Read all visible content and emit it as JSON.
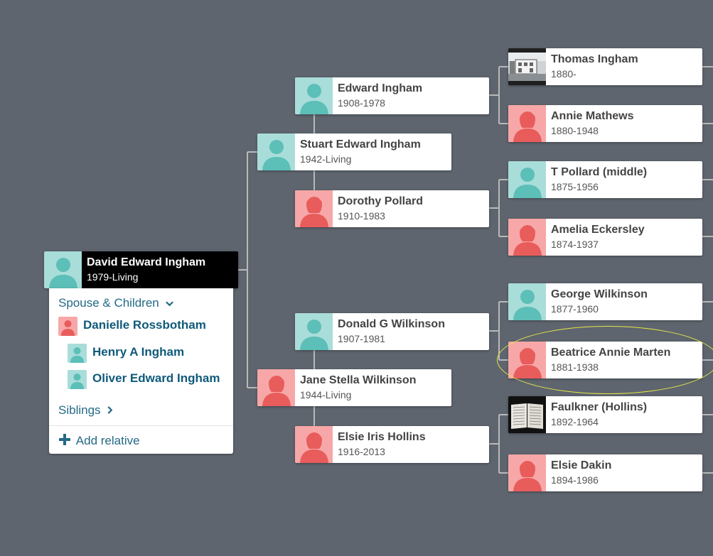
{
  "focus_person": {
    "name": "David Edward Ingham",
    "dates": "1979-Living"
  },
  "panel": {
    "spouse_children_label": "Spouse & Children",
    "spouse": "Danielle Rossbotham",
    "children": [
      "Henry A Ingham",
      "Oliver Edward Ingham"
    ],
    "siblings_label": "Siblings",
    "add_relative_label": "Add relative"
  },
  "parents": [
    {
      "name": "Stuart Edward Ingham",
      "dates": "1942-Living"
    },
    {
      "name": "Jane Stella Wilkinson",
      "dates": "1944-Living"
    }
  ],
  "grandparents": [
    {
      "name": "Edward Ingham",
      "dates": "1908-1978"
    },
    {
      "name": "Dorothy Pollard",
      "dates": "1910-1983"
    },
    {
      "name": "Donald G Wilkinson",
      "dates": "1907-1981"
    },
    {
      "name": "Elsie Iris Hollins",
      "dates": "1916-2013"
    }
  ],
  "great_grandparents": [
    {
      "name": "Thomas Ingham",
      "dates": "1880-"
    },
    {
      "name": "Annie Mathews",
      "dates": "1880-1948"
    },
    {
      "name": "T Pollard (middle)",
      "dates": "1875-1956"
    },
    {
      "name": "Amelia Eckersley",
      "dates": "1874-1937"
    },
    {
      "name": "George Wilkinson",
      "dates": "1877-1960"
    },
    {
      "name": "Beatrice Annie Marten",
      "dates": "1881-1938"
    },
    {
      "name": "Faulkner (Hollins)",
      "dates": "1892-1964"
    },
    {
      "name": "Elsie Dakin",
      "dates": "1894-1986"
    }
  ],
  "colors": {
    "background": "#5e656e",
    "male": "#a9ddd9",
    "female": "#f7a7a7",
    "link": "#236a86"
  }
}
